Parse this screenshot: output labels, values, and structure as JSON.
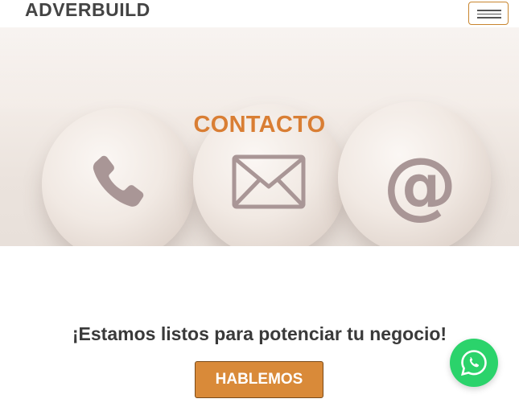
{
  "header": {
    "logo_text": "ADVERBUILD",
    "menu_icon": "hamburger-menu-icon"
  },
  "hero": {
    "title": "CONTACTO",
    "icons": [
      "phone-icon",
      "envelope-icon",
      "at-sign-icon"
    ],
    "at_symbol": "@"
  },
  "cta": {
    "text": "¡Estamos listos para potenciar tu negocio!",
    "button_label": "HABLEMOS"
  },
  "whatsapp": {
    "icon": "whatsapp-icon"
  },
  "colors": {
    "accent": "#d98a39",
    "title_orange": "#d97e34",
    "whatsapp_green": "#2bd36b",
    "text_dark": "#3a3a3a"
  }
}
